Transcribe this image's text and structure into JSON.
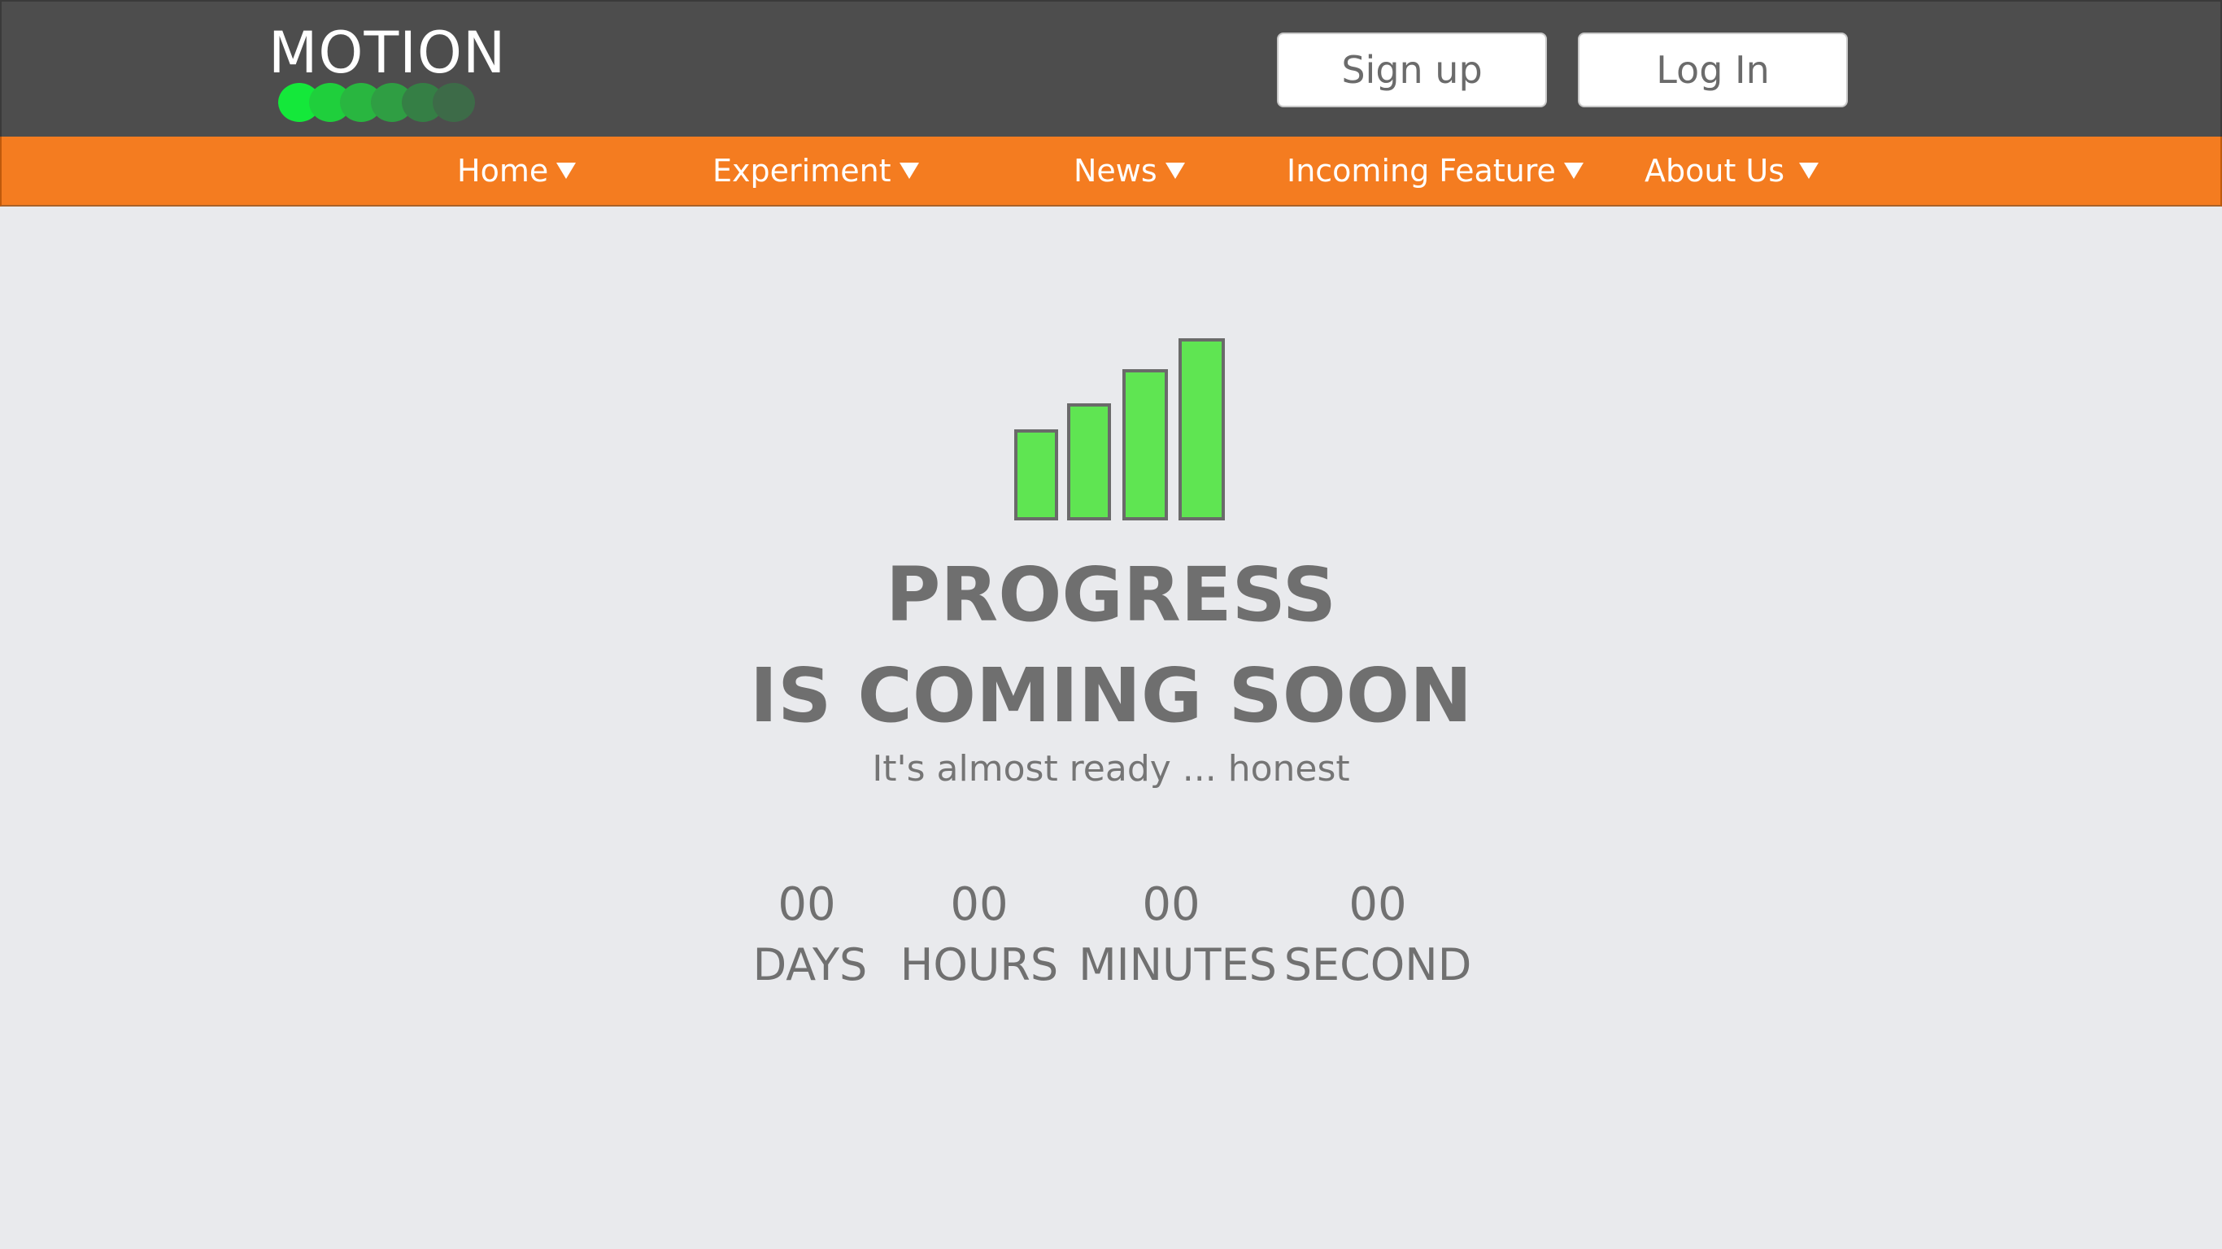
{
  "brand": {
    "name": "MOTION",
    "dot_colors": [
      "#14e83a",
      "#1fcf3c",
      "#29b640",
      "#2f9e43",
      "#357f45",
      "#3d6b48"
    ]
  },
  "auth": {
    "signup_label": "Sign up",
    "login_label": "Log In"
  },
  "nav": {
    "items": [
      {
        "label": "Home"
      },
      {
        "label": "Experiment"
      },
      {
        "label": "News"
      },
      {
        "label": "Incoming Feature"
      },
      {
        "label": "About Us"
      }
    ]
  },
  "hero": {
    "icon": "bar-chart-icon",
    "title": "PROGRESS",
    "subtitle": "IS COMING SOON",
    "tagline": "It's almost ready ... honest"
  },
  "countdown": [
    {
      "value": "00",
      "label": "DAYS"
    },
    {
      "value": "00",
      "label": "HOURS"
    },
    {
      "value": "00",
      "label": "MINUTES"
    },
    {
      "value": "00",
      "label": "SECOND"
    }
  ],
  "colors": {
    "header_bg": "#4d4d4d",
    "nav_bg": "#f47c20",
    "page_bg": "#e9eaed",
    "accent_green": "#5fe552"
  }
}
